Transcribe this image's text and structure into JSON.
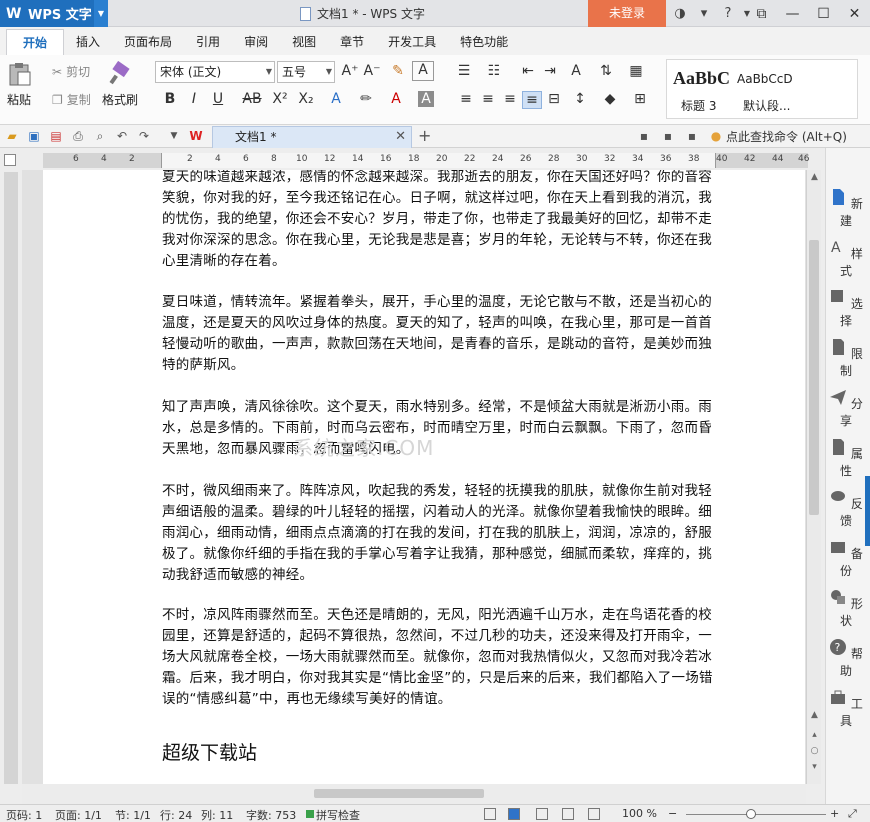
{
  "titlebar": {
    "app_name": "WPS 文字",
    "window_title": "文档1 * - WPS 文字",
    "login_label": "未登录"
  },
  "menu_tabs": [
    "开始",
    "插入",
    "页面布局",
    "引用",
    "审阅",
    "视图",
    "章节",
    "开发工具",
    "特色功能"
  ],
  "ribbon": {
    "paste_label": "粘贴",
    "cut_label": "剪切",
    "copy_label": "复制",
    "format_painter_label": "格式刷",
    "font_name": "宋体 (正文)",
    "font_size": "五号",
    "style_preview_1": "AaBbC",
    "style_preview_2": "AaBbCcD",
    "style_label_1": "标题 3",
    "style_label_2": "默认段..."
  },
  "quickbar": {
    "doc_tab_label": "文档1 *",
    "find_command": "点此查找命令 (Alt+Q)"
  },
  "ruler": {
    "numbers": [
      "6",
      "4",
      "2",
      "2",
      "4",
      "6",
      "8",
      "10",
      "12",
      "14",
      "16",
      "18",
      "20",
      "22",
      "24",
      "26",
      "28",
      "30",
      "32",
      "34",
      "36",
      "38",
      "40",
      "42",
      "44",
      "46"
    ]
  },
  "document": {
    "paragraphs": [
      "夏天的味道越来越浓，感情的怀念越来越深。我那逝去的朋友，你在天国还好吗？你的音容笑貌，你对我的好，至今我还铭记在心。日子啊，就这样过吧，你在天上看到我的消沉，我的忧伤，我的绝望，你还会不安心？岁月，带走了你，也带走了我最美好的回忆，却带不走我对你深深的思念。你在我心里，无论我是悲是喜；岁月的年轮，无论转与不转，你还在我心里清晰的存在着。",
      "夏日味道，情转流年。紧握着拳头，展开，手心里的温度，无论它散与不散，还是当初心的温度，还是夏天的风吹过身体的热度。夏天的知了，轻声的叫唤，在我心里，那可是一首首轻慢动听的歌曲，一声声，款款回荡在天地间，是青春的音乐，是跳动的音符，是美妙而独特的萨斯风。",
      "知了声声唤，清风徐徐吹。这个夏天，雨水特别多。经常，不是倾盆大雨就是淅沥小雨。雨水，总是多情的。下雨前，时而乌云密布，时而晴空万里，时而白云飘飘。下雨了，忽而昏天黑地，忽而暴风骤雨，忽而雷鸣闪电。",
      "不时，微风细雨来了。阵阵凉风，吹起我的秀发，轻轻的抚摸我的肌肤，就像你生前对我轻声细语般的温柔。碧绿的叶儿轻轻的摇摆，闪着动人的光泽。就像你望着我愉快的眼眸。细雨润心，细雨动情，细雨点点滴滴的打在我的发间，打在我的肌肤上，润润，凉凉的，舒服极了。就像你纤细的手指在我的手掌心写着字让我猜，那种感觉，细腻而柔软，痒痒的，挑动我舒适而敏感的神经。",
      "不时，凉风阵雨骤然而至。天色还是晴朗的，无风，阳光洒遍千山万水，走在鸟语花香的校园里，还算是舒适的，起码不算很热，忽然间，不过几秒的功夫，还没来得及打开雨伞，一场大风就席卷全校，一场大雨就骤然而至。就像你，忽而对我热情似火，又忽而对我冷若冰霜。后来，我才明白，你对我其实是“情比金坚”的，只是后来的后来，我们都陷入了一场错误的“情感纠葛”中，再也无缘续写美好的情谊。"
    ],
    "heading": "超级下载站",
    "watermark": "系统之家.COM"
  },
  "right_pane": {
    "items": [
      "新建",
      "样式",
      "选择",
      "限制",
      "分享",
      "属性",
      "反馈",
      "备份",
      "形状",
      "帮助",
      "工具"
    ]
  },
  "status": {
    "page_code": "页码: 1",
    "pages": "页面: 1/1",
    "section": "节: 1/1",
    "row": "行: 24",
    "col": "列: 11",
    "word_count": "字数: 753",
    "spell_check": "拼写检查",
    "zoom": "100 %"
  },
  "colors": {
    "accent": "#1f6fbd",
    "login": "#e9734a"
  }
}
